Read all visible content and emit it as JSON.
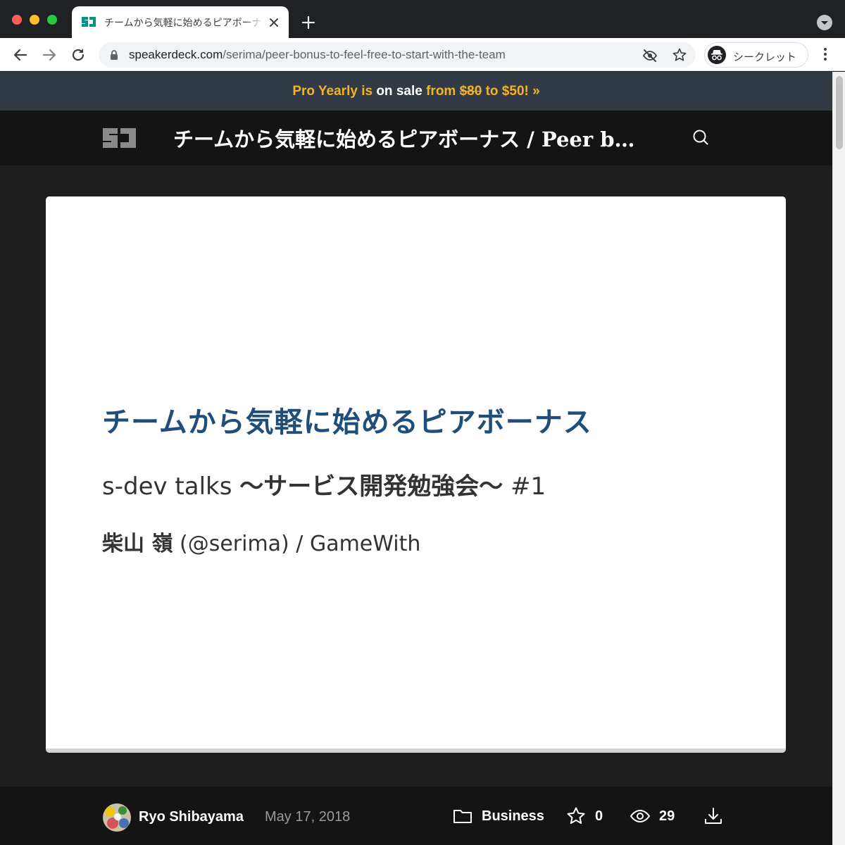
{
  "browser": {
    "tab_title": "チームから気軽に始めるピアボーナス / Peer bonus to feel free to start with the team",
    "url_domain": "speakerdeck.com",
    "url_path": "/serima/peer-bonus-to-feel-free-to-start-with-the-team",
    "profile_label": "シークレット"
  },
  "promo": {
    "part1": "Pro Yearly is",
    "part2": "on sale",
    "part3": "from",
    "old_price": "$80",
    "part4": "to $50! »"
  },
  "header": {
    "title": "チームから気軽に始めるピアボーナス / Peer bonus to feel free to start with the team"
  },
  "slide": {
    "title": "チームから気軽に始めるピアボーナス",
    "subtitle_prefix": "s-dev talks ",
    "subtitle_bold": "〜サービス開発勉強会〜",
    "subtitle_suffix": " #1",
    "author_bold": "柴山 嶺",
    "author_rest": " (@serima) / GameWith"
  },
  "footer": {
    "author": "Ryo Shibayama",
    "date": "May 17, 2018",
    "category": "Business",
    "stars": "0",
    "views": "29"
  },
  "colors": {
    "promo_accent": "#f5b321",
    "slide_title": "#1f4e7a",
    "brand_teal": "#009287"
  }
}
